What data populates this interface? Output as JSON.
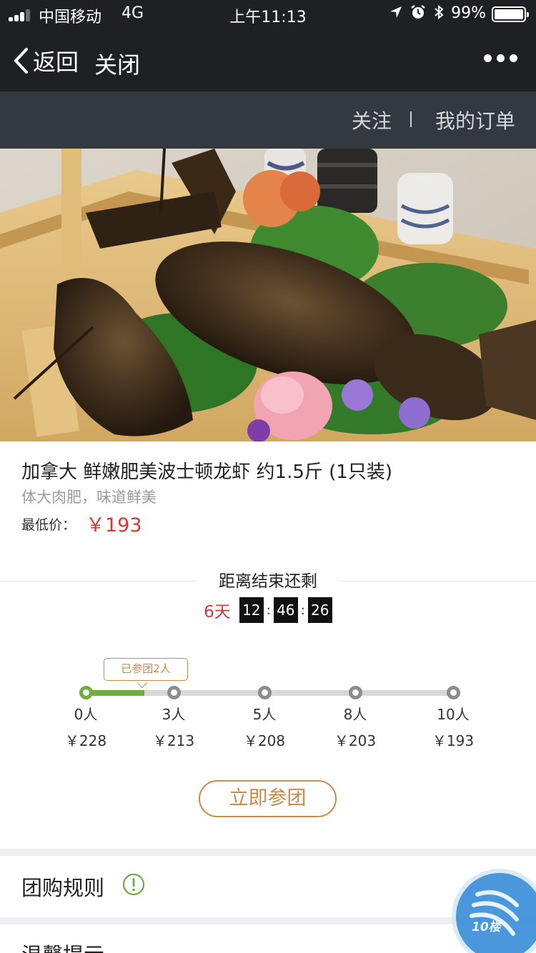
{
  "status_bar": {
    "carrier": "中国移动",
    "network": "4G",
    "time": "上午11:13",
    "battery_percent": "99%",
    "icons": [
      "location-arrow-icon",
      "alarm-icon",
      "bluetooth-icon"
    ]
  },
  "nav": {
    "back_label": "返回",
    "close_label": "关闭"
  },
  "sub_header": {
    "follow": "关注",
    "my_orders": "我的订单"
  },
  "product": {
    "title": "加拿大 鲜嫩肥美波士顿龙虾 约1.5斤 (1只装)",
    "subtitle": "体大肉肥，味道鲜美",
    "min_price_label": "最低价：",
    "min_price": "￥193"
  },
  "countdown": {
    "title": "距离结束还剩",
    "days": "6天",
    "hours": "12",
    "minutes": "46",
    "seconds": "26"
  },
  "group": {
    "joined_label": "已参团2人",
    "progress_fraction": 0.16,
    "tiers": [
      {
        "people": "0人",
        "price": "￥228"
      },
      {
        "people": "3人",
        "price": "￥213"
      },
      {
        "people": "5人",
        "price": "￥208"
      },
      {
        "people": "8人",
        "price": "￥203"
      },
      {
        "people": "10人",
        "price": "￥193"
      }
    ]
  },
  "join_button": "立即参团",
  "rules_title": "团购规则",
  "tips_title": "温馨提示",
  "badge_text": "10楼",
  "colors": {
    "price_red": "#d43a35",
    "accent_gold": "#c88a4a",
    "progress_green": "#6dae3f",
    "nav_bg": "#1f2023",
    "subnav_bg": "#343841"
  }
}
